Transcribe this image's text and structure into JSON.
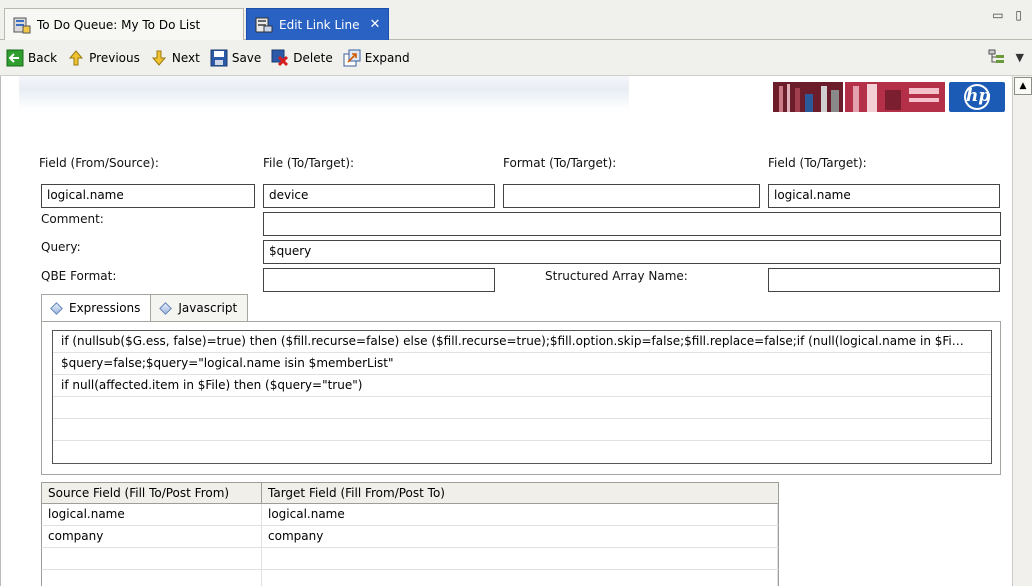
{
  "tabs": [
    {
      "label": "To Do Queue: My To Do List",
      "active": false
    },
    {
      "label": "Edit Link Line",
      "active": true,
      "close": "✕"
    }
  ],
  "window_controls": "▭ ▯",
  "toolbar": {
    "back_label": "Back",
    "previous_label": "Previous",
    "next_label": "Next",
    "save_label": "Save",
    "delete_label": "Delete",
    "expand_label": "Expand",
    "menu_arrow": "▼"
  },
  "form": {
    "field_from_label": "Field (From/Source):",
    "file_to_label": "File (To/Target):",
    "format_to_label": "Format (To/Target):",
    "field_to_label": "Field (To/Target):",
    "field_from_value": "logical.name",
    "file_to_value": "device",
    "format_to_value": "",
    "field_to_value": "logical.name",
    "comment_label": "Comment:",
    "comment_value": "",
    "query_label": "Query:",
    "query_value": "$query",
    "qbe_label": "QBE Format:",
    "qbe_value": "",
    "structured_label": "Structured Array Name:",
    "structured_value": ""
  },
  "panel": {
    "tab_expressions": "Expressions",
    "tab_javascript": "Javascript",
    "expressions": [
      "if (nullsub($G.ess, false)=true) then ($fill.recurse=false) else ($fill.recurse=true);$fill.option.skip=false;$fill.replace=false;if (null(logical.name in $Fi…",
      "$query=false;$query=\"logical.name isin $memberList\"",
      "if null(affected.item in $File) then ($query=\"true\")",
      "",
      "",
      ""
    ]
  },
  "grid": {
    "headers": [
      "Source Field (Fill To/Post From)",
      "Target Field (Fill From/Post To)"
    ],
    "rows": [
      [
        "logical.name",
        "logical.name"
      ],
      [
        "company",
        "company"
      ],
      [
        "",
        ""
      ],
      [
        "",
        ""
      ]
    ]
  },
  "logo_text": "hp",
  "colors": {
    "active_tab": "#2a62c4",
    "toolbar_bg": "#f0f0ec",
    "hp_blue": "#1c5bb5"
  }
}
